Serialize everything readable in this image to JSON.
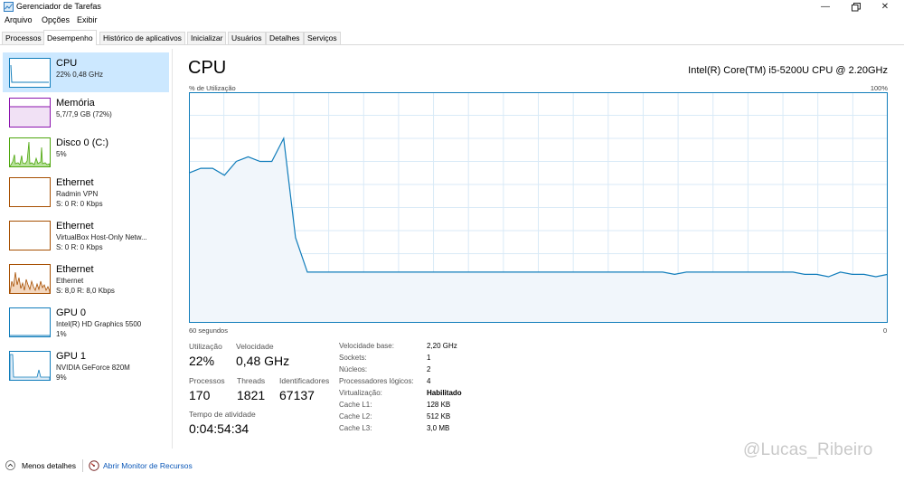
{
  "window": {
    "title": "Gerenciador de Tarefas"
  },
  "menu": [
    "Arquivo",
    "Opções",
    "Exibir"
  ],
  "tabs": [
    "Processos",
    "Desempenho",
    "Histórico de aplicativos",
    "Inicializar",
    "Usuários",
    "Detalhes",
    "Serviços"
  ],
  "active_tab": "Desempenho",
  "sidebar": [
    {
      "title": "CPU",
      "lines": [
        "22% 0,48 GHz"
      ],
      "color": "#117dbb"
    },
    {
      "title": "Memória",
      "lines": [
        "5,7/7,9 GB (72%)"
      ],
      "color": "#8b12ae"
    },
    {
      "title": "Disco 0 (C:)",
      "lines": [
        "5%"
      ],
      "color": "#4da60c"
    },
    {
      "title": "Ethernet",
      "lines": [
        "Radmin VPN",
        "S: 0 R: 0 Kbps"
      ],
      "color": "#a74f01"
    },
    {
      "title": "Ethernet",
      "lines": [
        "VirtualBox Host-Only Netw...",
        "S: 0 R: 0 Kbps"
      ],
      "color": "#a74f01"
    },
    {
      "title": "Ethernet",
      "lines": [
        "Ethernet",
        "S: 8,0 R: 8,0 Kbps"
      ],
      "color": "#a74f01"
    },
    {
      "title": "GPU 0",
      "lines": [
        "Intel(R) HD Graphics 5500",
        "1%"
      ],
      "color": "#117dbb"
    },
    {
      "title": "GPU 1",
      "lines": [
        "NVIDIA GeForce 820M",
        "9%"
      ],
      "color": "#117dbb"
    }
  ],
  "main": {
    "title": "CPU",
    "cpu_name": "Intel(R) Core(TM) i5-5200U CPU @ 2.20GHz",
    "y_label": "% de Utilização",
    "y_max": "100%",
    "x_left": "60 segundos",
    "x_right": "0"
  },
  "chart_data": {
    "type": "area",
    "ylim": [
      0,
      100
    ],
    "grid": true,
    "values": [
      65,
      67,
      67,
      64,
      70,
      72,
      70,
      70,
      80,
      37,
      22,
      22,
      22,
      22,
      22,
      22,
      22,
      22,
      22,
      22,
      22,
      22,
      22,
      22,
      22,
      22,
      22,
      22,
      22,
      22,
      22,
      22,
      22,
      22,
      22,
      22,
      22,
      22,
      22,
      22,
      22,
      21,
      22,
      22,
      22,
      22,
      22,
      22,
      22,
      22,
      22,
      22,
      21,
      21,
      20,
      22,
      21,
      21,
      20,
      21
    ]
  },
  "stats": {
    "utilizacao": {
      "label": "Utilização",
      "value": "22%"
    },
    "velocidade": {
      "label": "Velocidade",
      "value": "0,48 GHz"
    },
    "processos": {
      "label": "Processos",
      "value": "170"
    },
    "threads": {
      "label": "Threads",
      "value": "1821"
    },
    "identificadores": {
      "label": "Identificadores",
      "value": "67137"
    },
    "tempo": {
      "label": "Tempo de atividade",
      "value": "0:04:54:34"
    }
  },
  "specs": [
    {
      "label": "Velocidade base:",
      "value": "2,20 GHz"
    },
    {
      "label": "Sockets:",
      "value": "1"
    },
    {
      "label": "Núcleos:",
      "value": "2"
    },
    {
      "label": "Processadores lógicos:",
      "value": "4"
    },
    {
      "label": "Virtualização:",
      "value": "Habilitado"
    },
    {
      "label": "Cache L1:",
      "value": "128 KB"
    },
    {
      "label": "Cache L2:",
      "value": "512 KB"
    },
    {
      "label": "Cache L3:",
      "value": "3,0 MB"
    }
  ],
  "footer": {
    "less_details": "Menos detalhes",
    "resource_monitor": "Abrir Monitor de Recursos"
  },
  "watermark": "@Lucas_Ribeiro"
}
